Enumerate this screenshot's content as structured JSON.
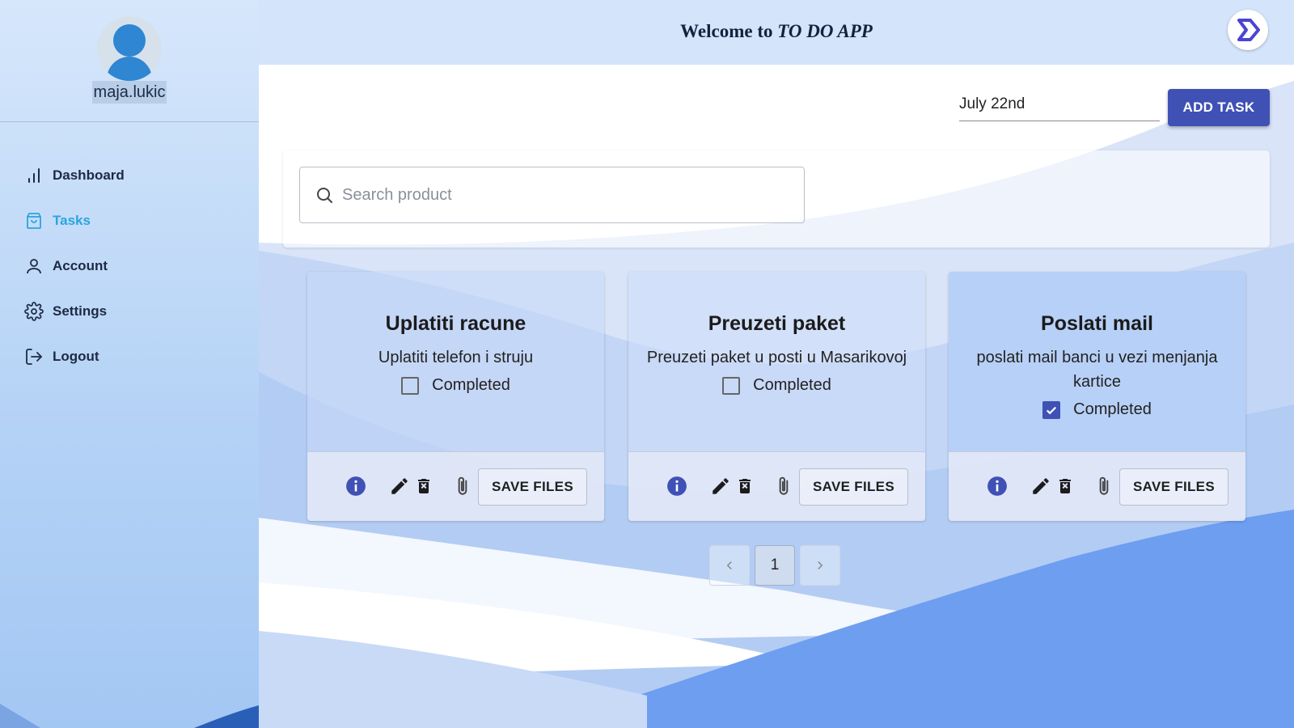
{
  "sidebar": {
    "username": "maja.lukic",
    "items": [
      {
        "label": "Dashboard",
        "icon": "bar-chart-icon"
      },
      {
        "label": "Tasks",
        "icon": "shopping-bag-icon"
      },
      {
        "label": "Account",
        "icon": "user-icon"
      },
      {
        "label": "Settings",
        "icon": "gear-icon"
      },
      {
        "label": "Logout",
        "icon": "logout-icon"
      }
    ],
    "active": "Tasks"
  },
  "header": {
    "title_prefix": "Welcome to",
    "title_app": "TO DO APP"
  },
  "toolbar": {
    "date_value": "July 22nd",
    "add_task_label": "ADD TASK"
  },
  "search": {
    "placeholder": "Search product"
  },
  "tasks": [
    {
      "title": "Uplatiti racune",
      "description": "Uplatiti telefon i struju",
      "completed_label": "Completed",
      "completed": false,
      "save_label": "SAVE FILES"
    },
    {
      "title": "Preuzeti paket",
      "description": "Preuzeti paket u posti u Masarikovoj",
      "completed_label": "Completed",
      "completed": false,
      "save_label": "SAVE FILES"
    },
    {
      "title": "Poslati mail",
      "description": "poslati mail banci u vezi menjanja kartice",
      "completed_label": "Completed",
      "completed": true,
      "save_label": "SAVE FILES"
    }
  ],
  "pagination": {
    "current_page": "1"
  },
  "colors": {
    "primary": "#3f51b5",
    "active_nav": "#2ba4e0",
    "card_open": "#c7d9f8",
    "card_done": "#b7d0f7"
  }
}
